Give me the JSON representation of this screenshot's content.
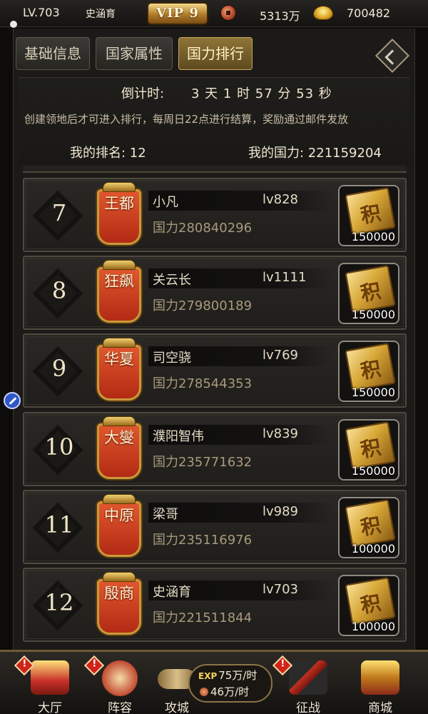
{
  "topbar": {
    "level": "LV.703",
    "player_name": "史涵育",
    "vip": "VIP 9",
    "coins": "5313万",
    "ingots": "700482"
  },
  "tabs": [
    {
      "label": "基础信息",
      "active": false
    },
    {
      "label": "国家属性",
      "active": false
    },
    {
      "label": "国力排行",
      "active": true
    }
  ],
  "info": {
    "countdown_label": "倒计时:",
    "countdown": "3 天 1 时 57 分 53 秒",
    "notice": "创建领地后才可进入排行，每周日22点进行结算，奖励通过邮件发放",
    "my_rank": "我的排名: 12",
    "my_power": "我的国力: 221159204"
  },
  "ranking": [
    {
      "rank": "7",
      "title": "王都",
      "name": "小凡",
      "level": "lv828",
      "power": "国力280840296",
      "reward": "150000"
    },
    {
      "rank": "8",
      "title": "狂飙",
      "name": "关云长",
      "level": "lv1111",
      "power": "国力279800189",
      "reward": "150000"
    },
    {
      "rank": "9",
      "title": "华夏",
      "name": "司空骁",
      "level": "lv769",
      "power": "国力278544353",
      "reward": "150000"
    },
    {
      "rank": "10",
      "title": "大燮",
      "name": "濮阳智伟",
      "level": "lv839",
      "power": "国力235771632",
      "reward": "150000"
    },
    {
      "rank": "11",
      "title": "中原",
      "name": "梁哥",
      "level": "lv989",
      "power": "国力235116976",
      "reward": "100000"
    },
    {
      "rank": "12",
      "title": "殷商",
      "name": "史涵育",
      "level": "lv703",
      "power": "国力221511844",
      "reward": "100000"
    }
  ],
  "reward_icon_char": "积",
  "bottom_nav": {
    "hall": "大厅",
    "formation": "阵容",
    "siege": "攻城",
    "campaign": "征战",
    "shop": "商城",
    "exp_tag": "EXP",
    "exp_rate": "75万/时",
    "coin_rate": "46万/时",
    "alert_mark": "!"
  },
  "colors": {
    "accent_gold": "#c9a65a",
    "tab_active": "#8e7438",
    "banner_red": "#b22a14",
    "alert_red": "#d02418"
  },
  "icons": {
    "coin": "copper-coin-icon",
    "ingot": "gold-ingot-icon",
    "settings": "diamond-menu-icon",
    "reward": "points-scroll-icon"
  }
}
